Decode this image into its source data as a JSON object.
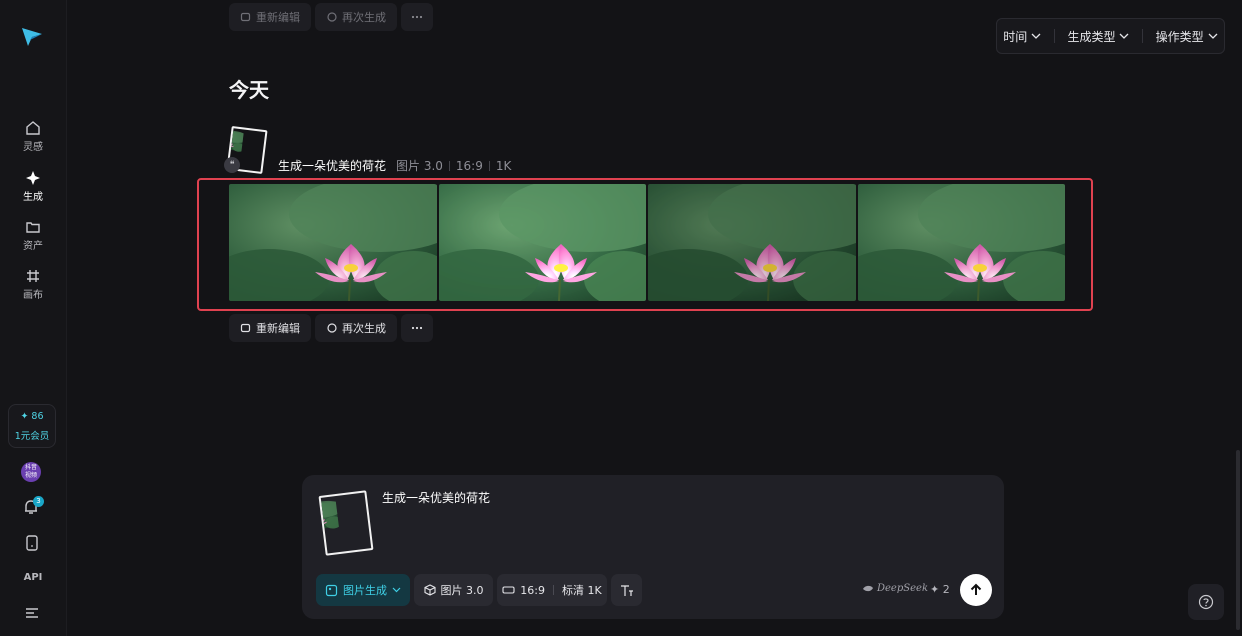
{
  "sidebar": {
    "logo_icon": "paper-plane-logo",
    "items": [
      {
        "label": "灵感",
        "icon": "home-icon",
        "active": false
      },
      {
        "label": "生成",
        "icon": "sparkle-icon",
        "active": true
      },
      {
        "label": "资产",
        "icon": "folder-icon",
        "active": false
      },
      {
        "label": "画布",
        "icon": "canvas-hash-icon",
        "active": false
      }
    ],
    "credits": {
      "amount": "✦ 86",
      "label": "1元会员"
    },
    "avatar_text": "抖音\n视频",
    "notification_count": "3",
    "api_label": "API"
  },
  "filters": [
    {
      "label": "时间"
    },
    {
      "label": "生成类型"
    },
    {
      "label": "操作类型"
    }
  ],
  "top_actions": {
    "edit": "重新编辑",
    "regenerate": "再次生成"
  },
  "section": {
    "title": "今天"
  },
  "record": {
    "prompt": "生成一朵优美的荷花",
    "model": "图片 3.0",
    "ratio": "16:9",
    "resolution": "1K",
    "quote_glyph": "❝",
    "image_count": 4
  },
  "record_actions": {
    "edit": "重新编辑",
    "regenerate": "再次生成"
  },
  "composer": {
    "prompt": "生成一朵优美的荷花",
    "mode": "图片生成",
    "model": "图片 3.0",
    "ratio": "16:9",
    "quality": "标清 1K",
    "deepseek": "DeepSeek",
    "cost": "✦ 2"
  },
  "colors": {
    "accent": "#3fd0e6",
    "highlight": "#e04250",
    "background": "#131316"
  }
}
